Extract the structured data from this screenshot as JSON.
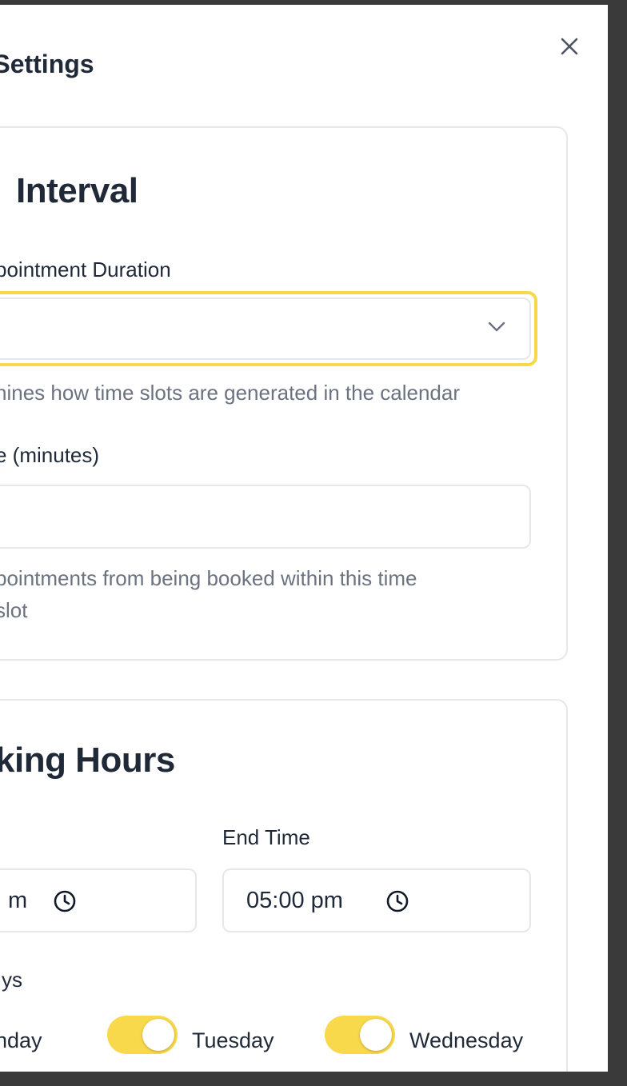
{
  "panel": {
    "title": "r Settings"
  },
  "interval": {
    "title": "Interval",
    "duration_label": "pointment Duration",
    "duration_value": "",
    "duration_help": "nines how time slots are generated in the calendar",
    "buffer_label": "e (minutes)",
    "buffer_value": "",
    "buffer_help_line1": "pointments from being booked within this time",
    "buffer_help_line2": "slot"
  },
  "hours": {
    "title": "king Hours",
    "start_value": "m",
    "end_label": "End Time",
    "end_value": "05:00 pm",
    "days_label": "ys",
    "days": [
      {
        "label": "nday",
        "enabled": true
      },
      {
        "label": "Tuesday",
        "enabled": true
      },
      {
        "label": "Wednesday",
        "enabled": true
      }
    ]
  },
  "colors": {
    "accent": "#f8d94c",
    "focus_border": "#f5d94a"
  }
}
